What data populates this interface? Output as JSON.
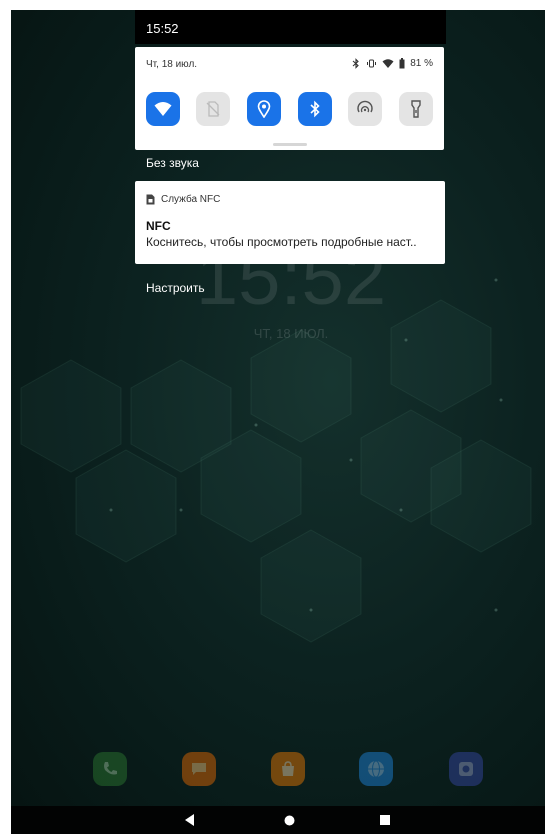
{
  "status_bar": {
    "time": "15:52"
  },
  "quick_settings": {
    "date": "Чт, 18 июл.",
    "battery_percent": "81 %",
    "tiles": [
      {
        "name": "wifi",
        "icon": "wifi-icon",
        "active": true
      },
      {
        "name": "no-sim",
        "icon": "no-sim-icon",
        "active": false
      },
      {
        "name": "location",
        "icon": "location-icon",
        "active": true
      },
      {
        "name": "bluetooth",
        "icon": "bluetooth-icon",
        "active": true
      },
      {
        "name": "nfc",
        "icon": "nfc-icon",
        "active": false
      },
      {
        "name": "flashlight",
        "icon": "flashlight-icon",
        "active": false
      }
    ],
    "accent_color": "#1a73e8"
  },
  "silent_section": {
    "label": "Без звука"
  },
  "notification": {
    "app_name": "Служба NFC",
    "title": "NFC",
    "text": "Коснитесь, чтобы просмотреть подробные наст.."
  },
  "manage_label": "Настроить",
  "lockscreen": {
    "clock": "15:52",
    "date": "ЧТ, 18 ИЮЛ."
  },
  "dock_apps": [
    {
      "icon": "phone-icon",
      "color": "#2e7d32"
    },
    {
      "icon": "messages-icon",
      "color": "#ef6c00"
    },
    {
      "icon": "store-icon",
      "color": "#f57c00"
    },
    {
      "icon": "browser-icon",
      "color": "#1e88e5"
    },
    {
      "icon": "camera-icon",
      "color": "#3949ab"
    }
  ],
  "nav_bar": {
    "buttons": [
      "back-icon",
      "home-icon",
      "recents-icon"
    ]
  }
}
